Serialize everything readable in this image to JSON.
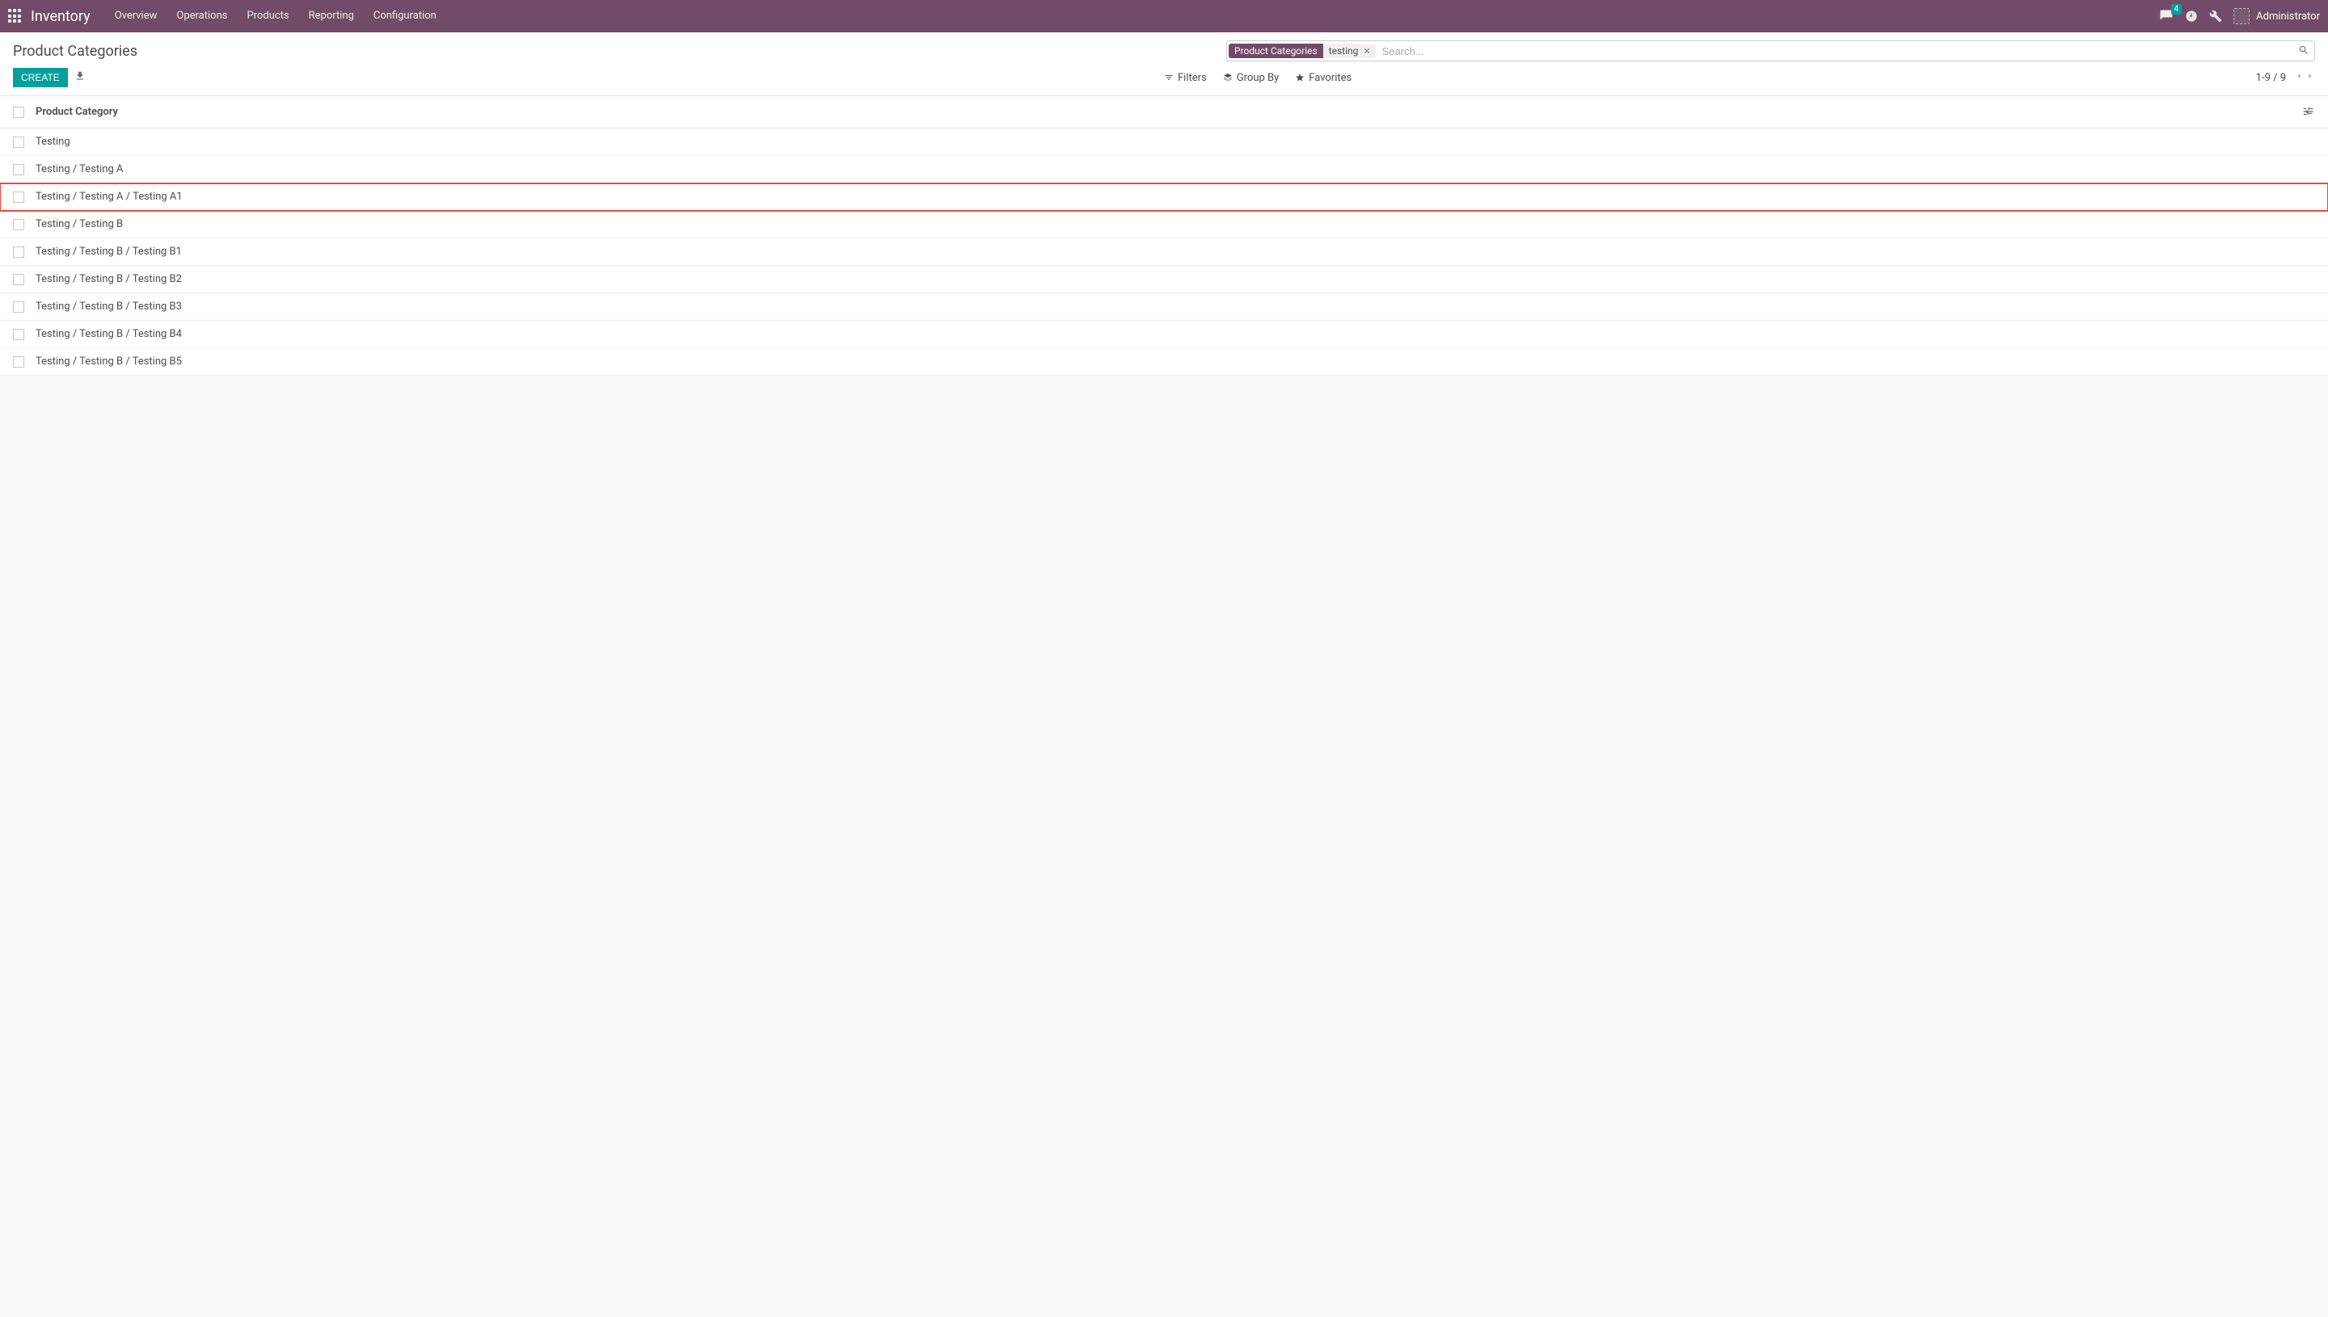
{
  "navbar": {
    "app": "Inventory",
    "menu": [
      "Overview",
      "Operations",
      "Products",
      "Reporting",
      "Configuration"
    ],
    "badge": "4",
    "user": "Administrator"
  },
  "breadcrumb": "Product Categories",
  "search": {
    "facet_label": "Product Categories",
    "facet_value": "testing",
    "placeholder": "Search..."
  },
  "toolbar": {
    "create": "CREATE",
    "filters": "Filters",
    "groupby": "Group By",
    "favorites": "Favorites",
    "pager": "1-9 / 9"
  },
  "list": {
    "column": "Product Category",
    "rows": [
      {
        "name": "Testing",
        "highlighted": false
      },
      {
        "name": "Testing / Testing A",
        "highlighted": false
      },
      {
        "name": "Testing / Testing A / Testing A1",
        "highlighted": true
      },
      {
        "name": "Testing / Testing B",
        "highlighted": false
      },
      {
        "name": "Testing / Testing B / Testing B1",
        "highlighted": false
      },
      {
        "name": "Testing / Testing B / Testing B2",
        "highlighted": false
      },
      {
        "name": "Testing / Testing B / Testing B3",
        "highlighted": false
      },
      {
        "name": "Testing / Testing B / Testing B4",
        "highlighted": false
      },
      {
        "name": "Testing / Testing B / Testing B5",
        "highlighted": false
      }
    ]
  }
}
